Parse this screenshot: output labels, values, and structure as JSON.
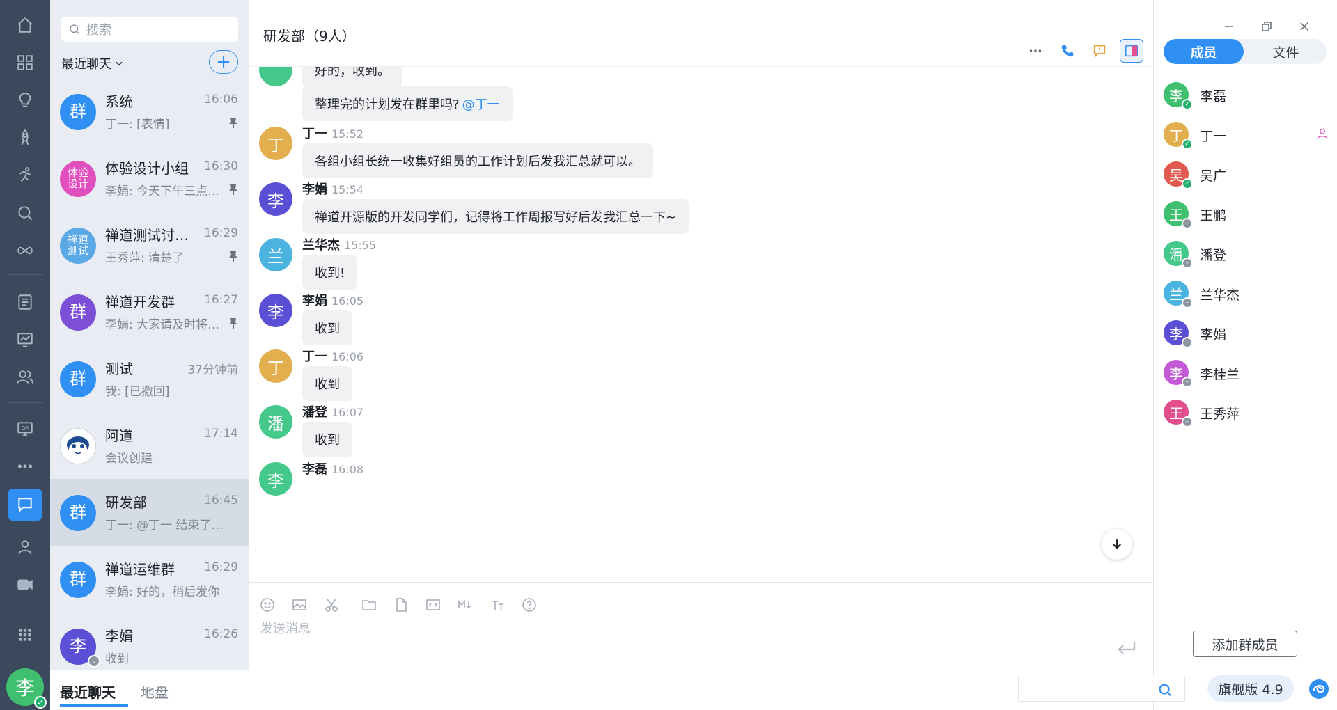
{
  "colors": {
    "accent": "#2f8ff2",
    "rail_bg": "#3a4a5c",
    "list_bg": "#e9edf3",
    "online": "#23b26d",
    "offline": "#8c96a0"
  },
  "sidebar": {
    "icons": [
      "home-icon",
      "apps-grid-icon",
      "lightbulb-icon",
      "rocket-icon",
      "running-icon",
      "search-magnifier-icon",
      "infinity-icon",
      "list-doc-icon",
      "monitor-chart-icon",
      "team-icon",
      "oa-monitor-icon",
      "more-dots-icon",
      "chat-bubble-icon",
      "contact-person-icon",
      "video-icon",
      "app-grid-icon"
    ],
    "active": "chat-bubble-icon",
    "me": {
      "avatar_char": "李"
    }
  },
  "chatlist": {
    "search_placeholder": "搜索",
    "filter_label": "最近聊天",
    "add_label": "+",
    "items": [
      {
        "avatar": "群",
        "color": "#2f8ff2",
        "name": "系统",
        "time": "16:06",
        "preview": "丁一: [表情]",
        "pinned": true
      },
      {
        "avatar": "体验设计",
        "color": "#e14fbe",
        "name": "体验设计小组",
        "time": "16:30",
        "preview": "李娟: 今天下午三点…",
        "pinned": true
      },
      {
        "avatar": "禅道测试",
        "color": "#5aa9e6",
        "name": "禅道测试讨…",
        "time": "16:29",
        "preview": "王秀萍: 清楚了",
        "pinned": true
      },
      {
        "avatar": "群",
        "color": "#7d4fd6",
        "name": "禅道开发群",
        "time": "16:27",
        "preview": "李娟: 大家请及时将…",
        "pinned": true
      },
      {
        "avatar": "群",
        "color": "#2f8ff2",
        "name": "测试",
        "time": "37分钟前",
        "preview": "我: [已撤回]",
        "pinned": false
      },
      {
        "avatar": "",
        "color": "#ffffff",
        "name": "阿道",
        "time": "17:14",
        "preview": "会议创建",
        "pinned": false
      },
      {
        "avatar": "群",
        "color": "#2f8ff2",
        "name": "研发部",
        "time": "16:45",
        "preview": "丁一: @丁一 结束了…",
        "pinned": false
      },
      {
        "avatar": "群",
        "color": "#2f8ff2",
        "name": "禅道运维群",
        "time": "16:29",
        "preview": "李娟: 好的，稍后发你",
        "pinned": false
      },
      {
        "avatar": "李",
        "color": "#5b4fd6",
        "name": "李娟",
        "time": "16:26",
        "preview": "收到",
        "pinned": false
      }
    ],
    "active_index": 6,
    "bottom_tabs": [
      "最近聊天",
      "地盘"
    ]
  },
  "main": {
    "title": "研发部（9人）",
    "messages": [
      {
        "sender": "",
        "time": "",
        "avatar": "",
        "color": "#45c98b",
        "text": "好的，收到。",
        "mention": ""
      },
      {
        "sender": "",
        "time": "",
        "avatar": "",
        "color": "",
        "text": "整理完的计划发在群里吗?",
        "mention": "@丁一"
      },
      {
        "sender": "丁一",
        "time": "15:52",
        "avatar": "丁",
        "color": "#e3ae4d",
        "text": "各组小组长统一收集好组员的工作计划后发我汇总就可以。",
        "mention": ""
      },
      {
        "sender": "李娟",
        "time": "15:54",
        "avatar": "李",
        "color": "#5b4fd6",
        "text": "禅道开源版的开发同学们，记得将工作周报写好后发我汇总一下~",
        "mention": ""
      },
      {
        "sender": "兰华杰",
        "time": "15:55",
        "avatar": "兰",
        "color": "#4ab3e0",
        "text": "收到!",
        "mention": ""
      },
      {
        "sender": "李娟",
        "time": "16:05",
        "avatar": "李",
        "color": "#5b4fd6",
        "text": "收到",
        "mention": ""
      },
      {
        "sender": "丁一",
        "time": "16:06",
        "avatar": "丁",
        "color": "#e3ae4d",
        "text": "收到",
        "mention": ""
      },
      {
        "sender": "潘登",
        "time": "16:07",
        "avatar": "潘",
        "color": "#45c98b",
        "text": "收到",
        "mention": ""
      },
      {
        "sender": "李磊",
        "time": "16:08",
        "avatar": "李",
        "color": "#45c98b",
        "text": "",
        "mention": ""
      }
    ],
    "composer_placeholder": "发送消息",
    "composer_tools": [
      "emoji-icon",
      "image-icon",
      "screenshot-scissors-icon",
      "folder-icon",
      "file-icon",
      "code-icon",
      "markdown-icon",
      "text-format-icon",
      "help-icon"
    ]
  },
  "right": {
    "tabs": [
      "成员",
      "文件"
    ],
    "members": [
      {
        "name": "李磊",
        "avatar": "李",
        "color": "#3fbf6f",
        "status": "online"
      },
      {
        "name": "丁一",
        "avatar": "丁",
        "color": "#e3ae4d",
        "status": "online"
      },
      {
        "name": "吴广",
        "avatar": "吴",
        "color": "#e1594f",
        "status": "online"
      },
      {
        "name": "王鹏",
        "avatar": "王",
        "color": "#3fbf6f",
        "status": "offline"
      },
      {
        "name": "潘登",
        "avatar": "潘",
        "color": "#45c98b",
        "status": "offline"
      },
      {
        "name": "兰华杰",
        "avatar": "兰",
        "color": "#4ab3e0",
        "status": "offline"
      },
      {
        "name": "李娟",
        "avatar": "李",
        "color": "#5b4fd6",
        "status": "offline"
      },
      {
        "name": "李桂兰",
        "avatar": "李",
        "color": "#c45ad6",
        "status": "offline"
      },
      {
        "name": "王秀萍",
        "avatar": "王",
        "color": "#e14f8f",
        "status": "offline"
      }
    ],
    "add_member_label": "添加群成员"
  },
  "statusbar": {
    "version": "旗舰版 4.9"
  }
}
